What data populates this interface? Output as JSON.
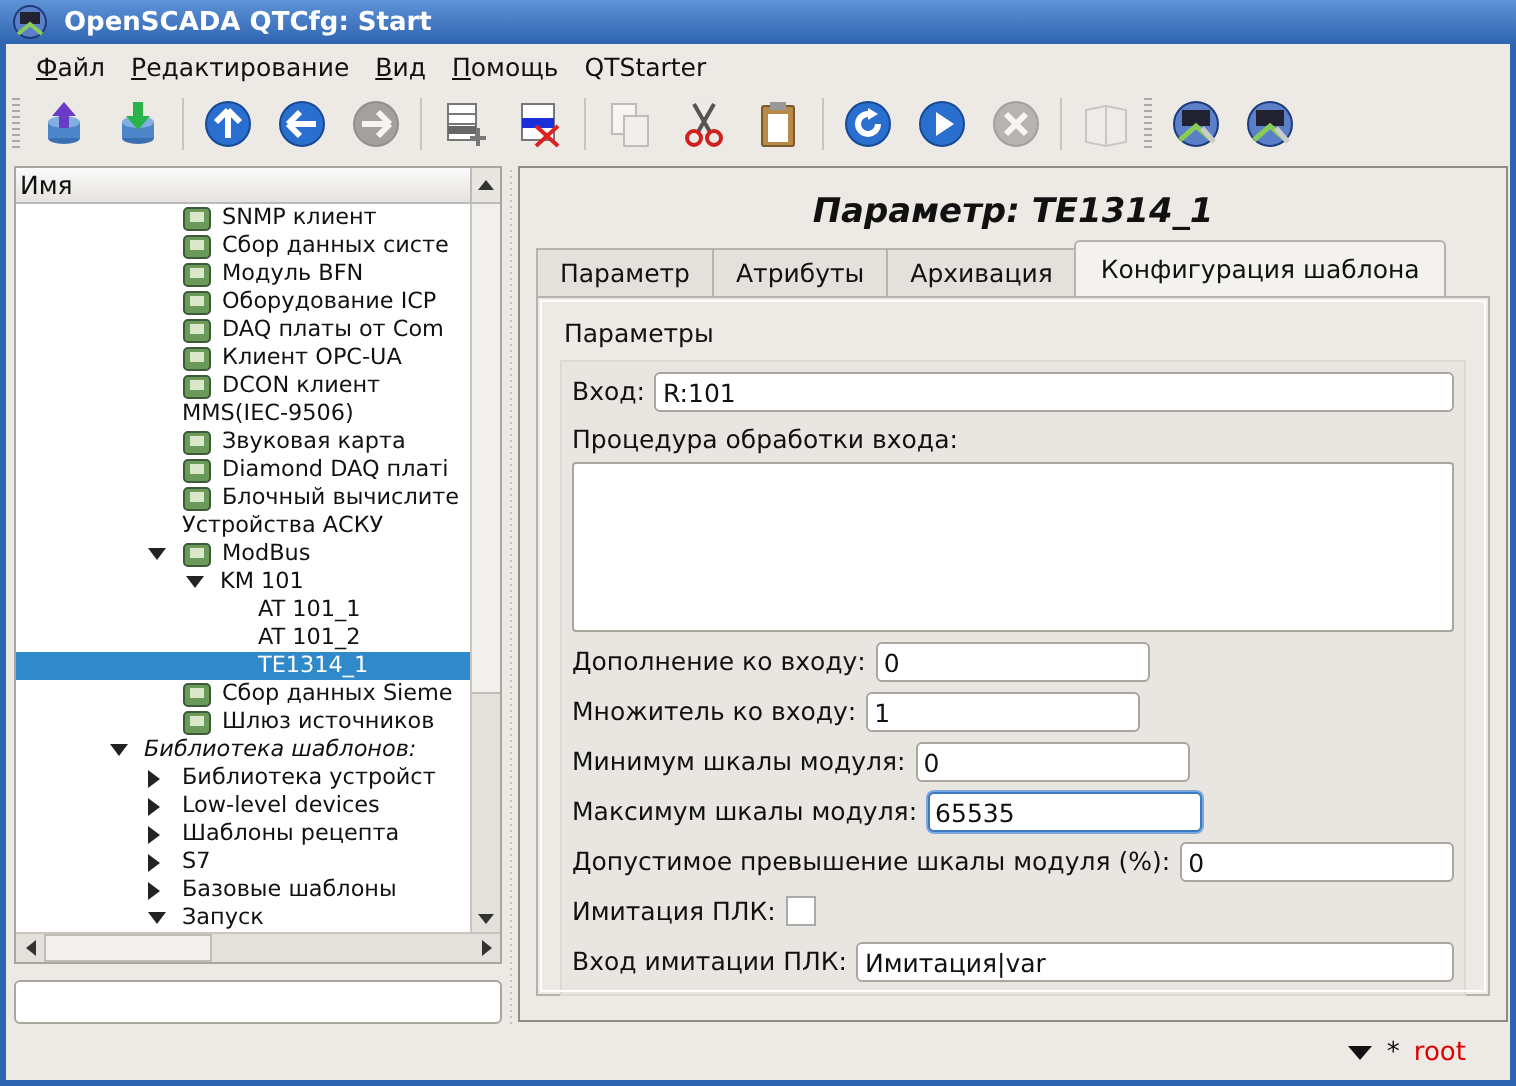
{
  "window": {
    "title": "OpenSCADA QTCfg: Start"
  },
  "menu": [
    {
      "label": "Файл",
      "mnemonic": true
    },
    {
      "label": "Редактирование",
      "mnemonic": true
    },
    {
      "label": "Вид",
      "mnemonic": true
    },
    {
      "label": "Помощь",
      "mnemonic": true
    },
    {
      "label": "QTStarter",
      "mnemonic": false
    }
  ],
  "toolbars": [
    {
      "groups": [
        [
          {
            "kind": "load",
            "disabled": false
          },
          {
            "kind": "save",
            "disabled": false
          }
        ],
        [
          {
            "kind": "up",
            "disabled": false
          },
          {
            "kind": "back",
            "disabled": false
          },
          {
            "kind": "forward",
            "disabled": true
          }
        ],
        [
          {
            "kind": "add",
            "disabled": false
          },
          {
            "kind": "delete",
            "disabled": false
          }
        ],
        [
          {
            "kind": "copy",
            "disabled": true
          },
          {
            "kind": "cut",
            "disabled": false
          },
          {
            "kind": "paste",
            "disabled": false
          }
        ],
        [
          {
            "kind": "refresh",
            "disabled": false
          },
          {
            "kind": "play",
            "disabled": false
          },
          {
            "kind": "stop",
            "disabled": true
          }
        ],
        [
          {
            "kind": "manual",
            "disabled": true
          }
        ]
      ]
    },
    {
      "groups": [
        [
          {
            "kind": "station",
            "disabled": false
          },
          {
            "kind": "station",
            "disabled": false
          }
        ]
      ]
    }
  ],
  "tree": {
    "header": "Имя",
    "items": [
      {
        "children": [
          {
            "label": "SNMP клиент",
            "kind": "module",
            "selected": false
          },
          {
            "label": "Сбор данных систе",
            "kind": "module",
            "selected": false
          },
          {
            "label": "Модуль BFN",
            "kind": "module",
            "selected": false
          },
          {
            "label": "Оборудование ICP",
            "kind": "module",
            "selected": false
          },
          {
            "label": "DAQ платы от Com",
            "kind": "module",
            "selected": false
          },
          {
            "label": "Клиент OPC-UA",
            "kind": "module",
            "selected": false
          },
          {
            "label": "DCON клиент",
            "kind": "module",
            "selected": false
          },
          {
            "label": "MMS(IEC-9506)",
            "kind": "plain",
            "selected": false
          },
          {
            "label": "Звуковая карта",
            "kind": "module",
            "selected": false
          },
          {
            "label": "Diamond DAQ платі",
            "kind": "module",
            "selected": false
          },
          {
            "label": "Блочный вычислите",
            "kind": "module",
            "selected": false
          },
          {
            "label": "Устройства АСКУ",
            "kind": "plain",
            "selected": false
          },
          {
            "label": "ModBus",
            "kind": "module",
            "selected": false,
            "expanded": true,
            "children": [
              {
                "label": "KM 101",
                "kind": "plain",
                "selected": false,
                "expanded": true,
                "children": [
                  {
                    "label": "AT 101_1",
                    "kind": "plain",
                    "selected": false
                  },
                  {
                    "label": "AT 101_2",
                    "kind": "plain",
                    "selected": false
                  },
                  {
                    "label": "TE1314_1",
                    "kind": "plain",
                    "selected": true
                  }
                ]
              }
            ]
          },
          {
            "label": "Сбор данных Sieme",
            "kind": "module",
            "selected": false
          },
          {
            "label": "Шлюз источников",
            "kind": "module",
            "selected": false
          }
        ]
      },
      {
        "label": "Библиотека шаблонов:",
        "kind": "group",
        "selected": false,
        "expanded": true,
        "children": [
          {
            "label": "Библиотека устройст",
            "kind": "plain",
            "selected": false,
            "expanded": false
          },
          {
            "label": "Low-level devices",
            "kind": "plain",
            "selected": false,
            "expanded": false
          },
          {
            "label": "Шаблоны рецепта",
            "kind": "plain",
            "selected": false,
            "expanded": false
          },
          {
            "label": "S7",
            "kind": "plain",
            "selected": false,
            "expanded": false
          },
          {
            "label": "Базовые шаблоны",
            "kind": "plain",
            "selected": false,
            "expanded": false
          },
          {
            "label": "Запуск",
            "kind": "plain",
            "selected": false,
            "expanded": true
          }
        ]
      }
    ]
  },
  "page": {
    "title": "Параметр: TE1314_1",
    "tabs": [
      {
        "label": "Параметр",
        "selected": false
      },
      {
        "label": "Атрибуты",
        "selected": false
      },
      {
        "label": "Архивация",
        "selected": false
      },
      {
        "label": "Конфигурация шаблона",
        "selected": true
      }
    ],
    "group": "Параметры",
    "fields": [
      {
        "kind": "wide",
        "label": "Вход:",
        "value": "R:101",
        "focused": false
      },
      {
        "kind": "multiline",
        "label": "Процедура обработки входа:",
        "focused": false
      },
      {
        "kind": "short",
        "label": "Дополнение ко входу:",
        "value": "0",
        "focused": false
      },
      {
        "kind": "short",
        "label": "Множитель ко входу:",
        "value": "1",
        "focused": false
      },
      {
        "kind": "short",
        "label": "Минимум шкалы модуля:",
        "value": "0",
        "focused": false
      },
      {
        "kind": "short",
        "label": "Максимум шкалы модуля:",
        "value": "65535",
        "focused": true
      },
      {
        "kind": "wide",
        "label": "Допустимое превышение шкалы модуля (%):",
        "value": "0",
        "focused": false
      },
      {
        "kind": "checkbox",
        "label": "Имитация ПЛК:",
        "checked": false
      },
      {
        "kind": "wide",
        "label": "Вход имитации ПЛК:",
        "value": "Имитация|var",
        "focused": false
      }
    ]
  },
  "status_bar": {
    "marker": "*",
    "user": "root"
  }
}
